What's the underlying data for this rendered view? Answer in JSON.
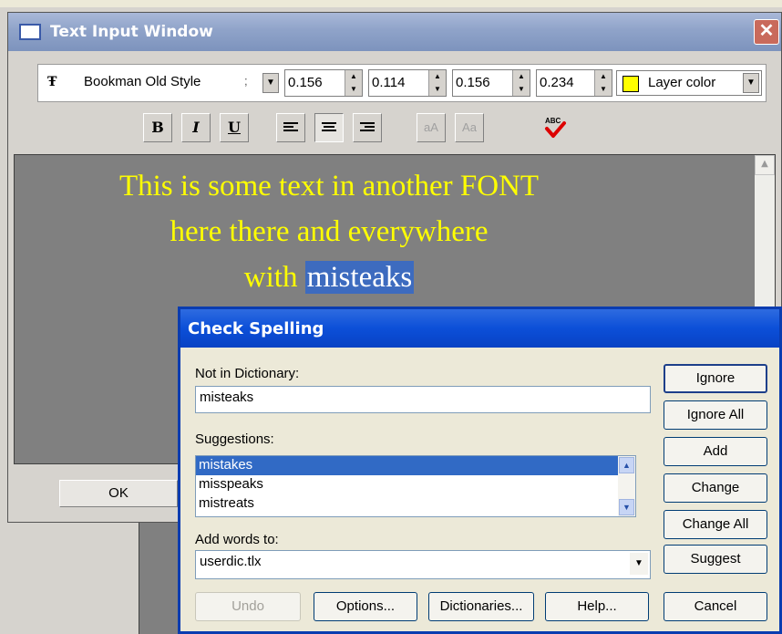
{
  "text_input_window": {
    "title": "Text Input Window",
    "close_glyph": "✕",
    "font": {
      "name": "Bookman Old Style",
      "extra": ";",
      "icon": "Ŧ"
    },
    "spinners": [
      "0.156",
      "0.114",
      "0.156",
      "0.234"
    ],
    "color": {
      "label": "Layer color",
      "swatch": "#ffff00"
    },
    "format_buttons": {
      "bold": "B",
      "italic": "I",
      "underline": "U",
      "lower": "aA",
      "title": "Aa"
    },
    "editor_lines": [
      "This is some text in another FONT",
      "here there and everywhere",
      "with "
    ],
    "selected_word": "misteaks",
    "ok_label": "OK"
  },
  "check_spelling": {
    "title": "Check Spelling",
    "not_in_dictionary_label": "Not in Dictionary:",
    "not_in_dictionary_value": "misteaks",
    "suggestions_label": "Suggestions:",
    "suggestions": [
      "mistakes",
      "misspeaks",
      "mistreats"
    ],
    "add_words_label": "Add words to:",
    "add_words_value": "userdic.tlx",
    "buttons": {
      "ignore": "Ignore",
      "ignore_all": "Ignore All",
      "add": "Add",
      "change": "Change",
      "change_all": "Change All",
      "suggest": "Suggest",
      "undo": "Undo",
      "options": "Options...",
      "dictionaries": "Dictionaries...",
      "help": "Help...",
      "cancel": "Cancel"
    }
  }
}
